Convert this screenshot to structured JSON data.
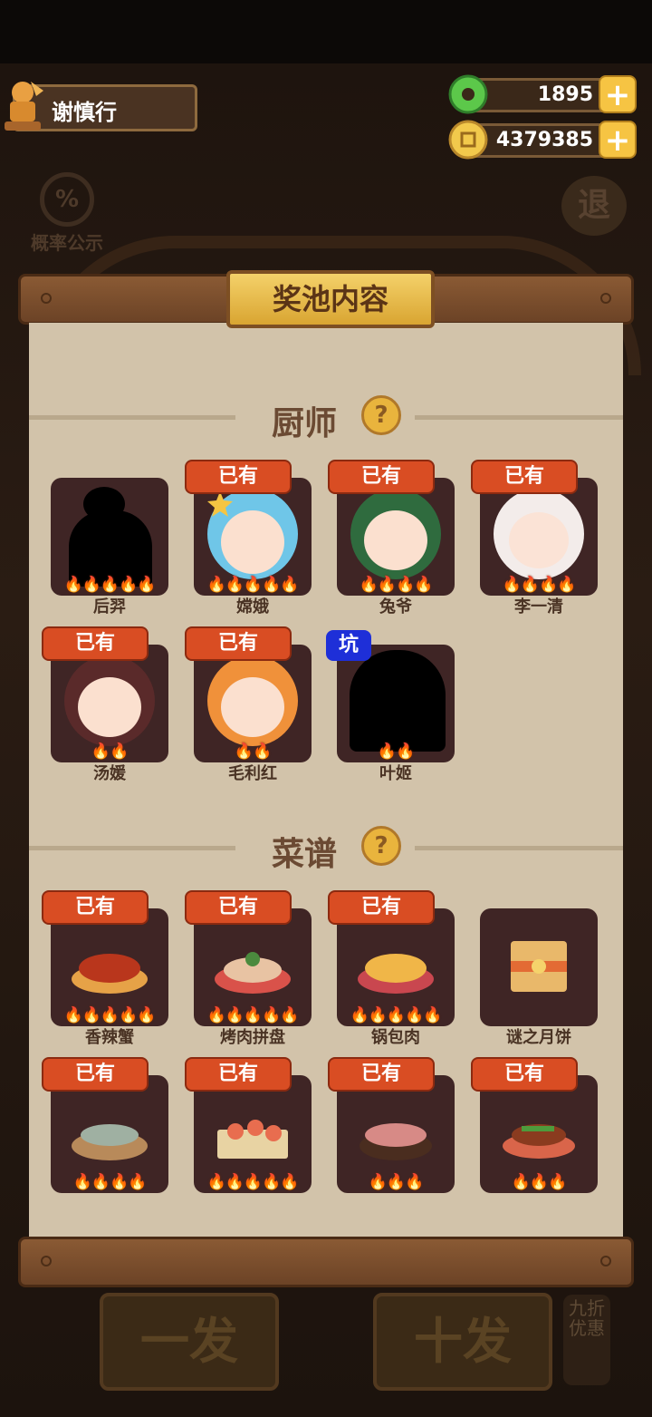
{
  "player": {
    "name": "谢慎行"
  },
  "resources": {
    "jade": "1895",
    "coins": "4379385",
    "plus": "+"
  },
  "background": {
    "probability_icon": "%",
    "probability_label": "概率公示",
    "exit_label": "退",
    "single_draw": "一发",
    "ten_draw": "十发",
    "discount": "九折优惠"
  },
  "panel": {
    "title": "奖池内容"
  },
  "sections": {
    "chefs_title": "厨师",
    "recipes_title": "菜谱",
    "help": "?"
  },
  "badges": {
    "owned": "已有",
    "pit": "坑"
  },
  "chefs": [
    {
      "name": "后羿",
      "stars": 5
    },
    {
      "name": "嫦娥",
      "stars": 5
    },
    {
      "name": "兔爷",
      "stars": 4
    },
    {
      "name": "李一清",
      "stars": 4
    },
    {
      "name": "汤媛",
      "stars": 2
    },
    {
      "name": "毛利红",
      "stars": 2
    },
    {
      "name": "叶姬",
      "stars": 2
    }
  ],
  "recipes": [
    {
      "name": "香辣蟹",
      "stars": 5
    },
    {
      "name": "烤肉拼盘",
      "stars": 5
    },
    {
      "name": "锅包肉",
      "stars": 5
    },
    {
      "name": "谜之月饼",
      "stars": 0
    },
    {
      "name": "",
      "stars": 4
    },
    {
      "name": "",
      "stars": 5
    },
    {
      "name": "",
      "stars": 3
    },
    {
      "name": "",
      "stars": 3
    }
  ],
  "colors": {
    "owned_badge": "#d94d23",
    "pit_badge": "#1e2fd8",
    "tile": "#3f2525",
    "paper": "#d2c3aa"
  }
}
